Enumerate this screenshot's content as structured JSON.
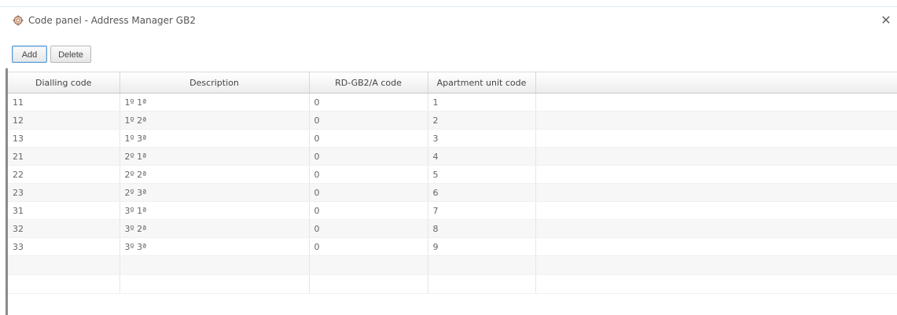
{
  "window": {
    "title": "Code panel - Address Manager GB2",
    "close_glyph": "✕"
  },
  "toolbar": {
    "add_label": "Add",
    "delete_label": "Delete"
  },
  "table": {
    "columns": [
      "Dialling code",
      "Description",
      "RD-GB2/A code",
      "Apartment unit code"
    ],
    "rows": [
      [
        "11",
        "1º 1ª",
        "0",
        "1"
      ],
      [
        "12",
        "1º 2ª",
        "0",
        "2"
      ],
      [
        "13",
        "1º 3ª",
        "0",
        "3"
      ],
      [
        "21",
        "2º 1ª",
        "0",
        "4"
      ],
      [
        "22",
        "2º 2ª",
        "0",
        "5"
      ],
      [
        "23",
        "2º 3ª",
        "0",
        "6"
      ],
      [
        "31",
        "3º 1ª",
        "0",
        "7"
      ],
      [
        "32",
        "3º 2ª",
        "0",
        "8"
      ],
      [
        "33",
        "3º 3ª",
        "0",
        "9"
      ]
    ]
  },
  "icons": {
    "title_icon": "app-gear-icon",
    "close_icon": "close-icon"
  }
}
